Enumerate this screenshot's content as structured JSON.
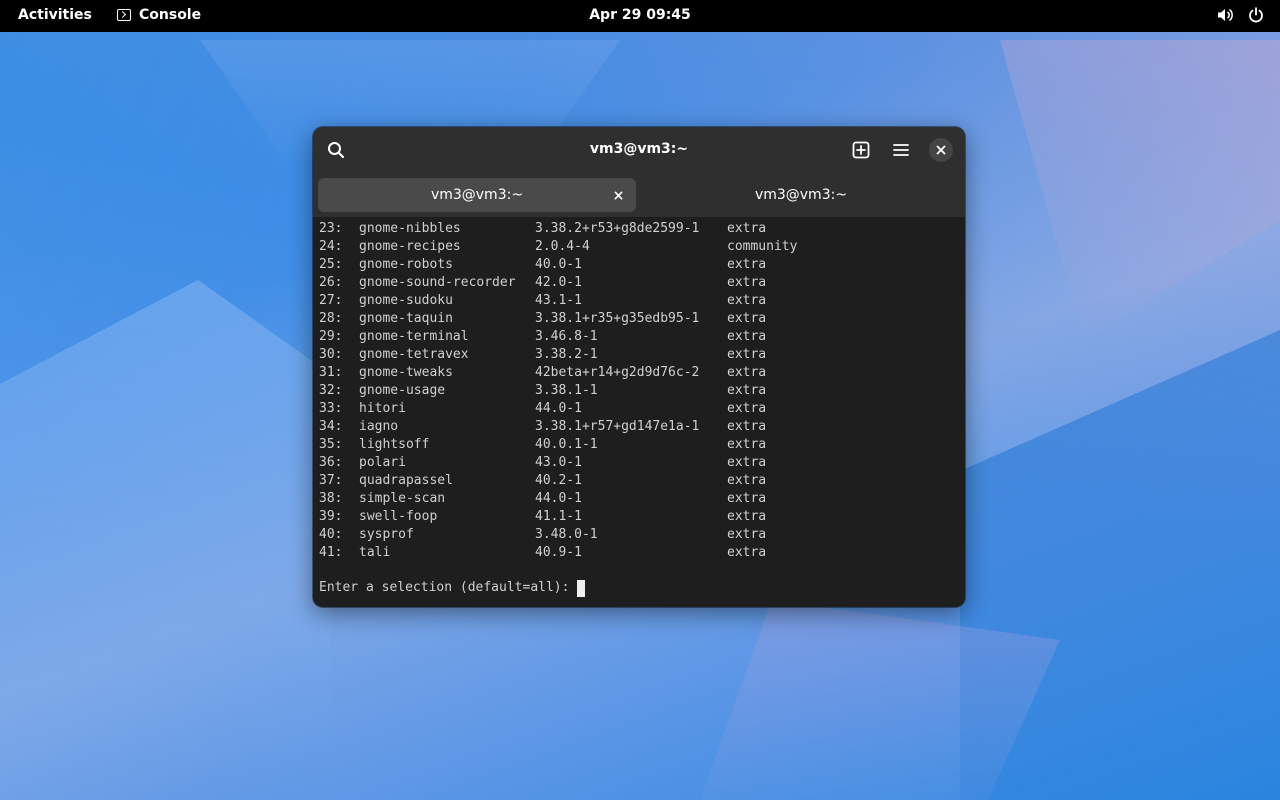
{
  "topbar": {
    "activities": "Activities",
    "app_name": "Console",
    "clock": "Apr 29  09:45",
    "tray_icons": [
      "volume-icon",
      "power-icon"
    ]
  },
  "window": {
    "title": "vm3@vm3:~",
    "tabs": [
      {
        "label": "vm3@vm3:~",
        "active": true
      },
      {
        "label": "vm3@vm3:~",
        "active": false
      }
    ]
  },
  "terminal": {
    "rows": [
      {
        "num": "23:",
        "name": "gnome-nibbles",
        "version": "3.38.2+r53+g8de2599-1",
        "repo": "extra"
      },
      {
        "num": "24:",
        "name": "gnome-recipes",
        "version": "2.0.4-4",
        "repo": "community"
      },
      {
        "num": "25:",
        "name": "gnome-robots",
        "version": "40.0-1",
        "repo": "extra"
      },
      {
        "num": "26:",
        "name": "gnome-sound-recorder",
        "version": "42.0-1",
        "repo": "extra"
      },
      {
        "num": "27:",
        "name": "gnome-sudoku",
        "version": "43.1-1",
        "repo": "extra"
      },
      {
        "num": "28:",
        "name": "gnome-taquin",
        "version": "3.38.1+r35+g35edb95-1",
        "repo": "extra"
      },
      {
        "num": "29:",
        "name": "gnome-terminal",
        "version": "3.46.8-1",
        "repo": "extra"
      },
      {
        "num": "30:",
        "name": "gnome-tetravex",
        "version": "3.38.2-1",
        "repo": "extra"
      },
      {
        "num": "31:",
        "name": "gnome-tweaks",
        "version": "42beta+r14+g2d9d76c-2",
        "repo": "extra"
      },
      {
        "num": "32:",
        "name": "gnome-usage",
        "version": "3.38.1-1",
        "repo": "extra"
      },
      {
        "num": "33:",
        "name": "hitori",
        "version": "44.0-1",
        "repo": "extra"
      },
      {
        "num": "34:",
        "name": "iagno",
        "version": "3.38.1+r57+gd147e1a-1",
        "repo": "extra"
      },
      {
        "num": "35:",
        "name": "lightsoff",
        "version": "40.0.1-1",
        "repo": "extra"
      },
      {
        "num": "36:",
        "name": "polari",
        "version": "43.0-1",
        "repo": "extra"
      },
      {
        "num": "37:",
        "name": "quadrapassel",
        "version": "40.2-1",
        "repo": "extra"
      },
      {
        "num": "38:",
        "name": "simple-scan",
        "version": "44.0-1",
        "repo": "extra"
      },
      {
        "num": "39:",
        "name": "swell-foop",
        "version": "41.1-1",
        "repo": "extra"
      },
      {
        "num": "40:",
        "name": "sysprof",
        "version": "3.48.0-1",
        "repo": "extra"
      },
      {
        "num": "41:",
        "name": "tali",
        "version": "40.9-1",
        "repo": "extra"
      }
    ],
    "prompt": "Enter a selection (default=all):"
  },
  "colors": {
    "topbar_bg": "#000000",
    "headerbar_bg": "#2f2f2f",
    "terminal_bg": "#1e1e1e",
    "terminal_fg": "#d0d0d0",
    "active_tab_bg": "#4a4a4a"
  }
}
